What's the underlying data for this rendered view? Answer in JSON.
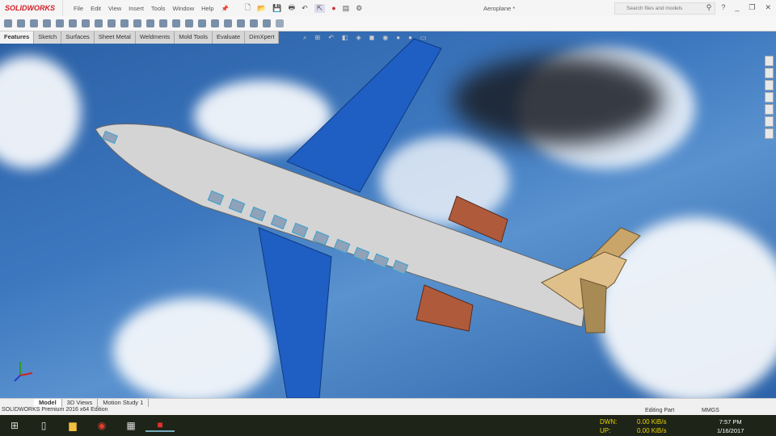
{
  "app": {
    "logo": "SOLIDWORKS",
    "document_title": "Aeroplane *"
  },
  "menu": [
    "File",
    "Edit",
    "View",
    "Insert",
    "Tools",
    "Window",
    "Help"
  ],
  "search": {
    "placeholder": "Search files and models"
  },
  "command_tabs": [
    "Features",
    "Sketch",
    "Surfaces",
    "Sheet Metal",
    "Weldments",
    "Mold Tools",
    "Evaluate",
    "DimXpert"
  ],
  "bottom_tabs": [
    "Model",
    "3D Views",
    "Motion Study 1"
  ],
  "status": {
    "edition": "SOLIDWORKS Premium 2016 x64 Edition",
    "mode": "Editing Part",
    "units": "MMGS"
  },
  "taskbar": {
    "dwn_label": "DWN:",
    "up_label": "UP:",
    "dwn": "0.00 KiB/s",
    "up": "0.00 KiB/s",
    "time": "7:57 PM",
    "date": "1/16/2017"
  },
  "colors": {
    "wing": "#1f5fc4",
    "fuselage": "#d4d4d4",
    "engine": "#b05a3c",
    "tail": "#c9a56a"
  }
}
